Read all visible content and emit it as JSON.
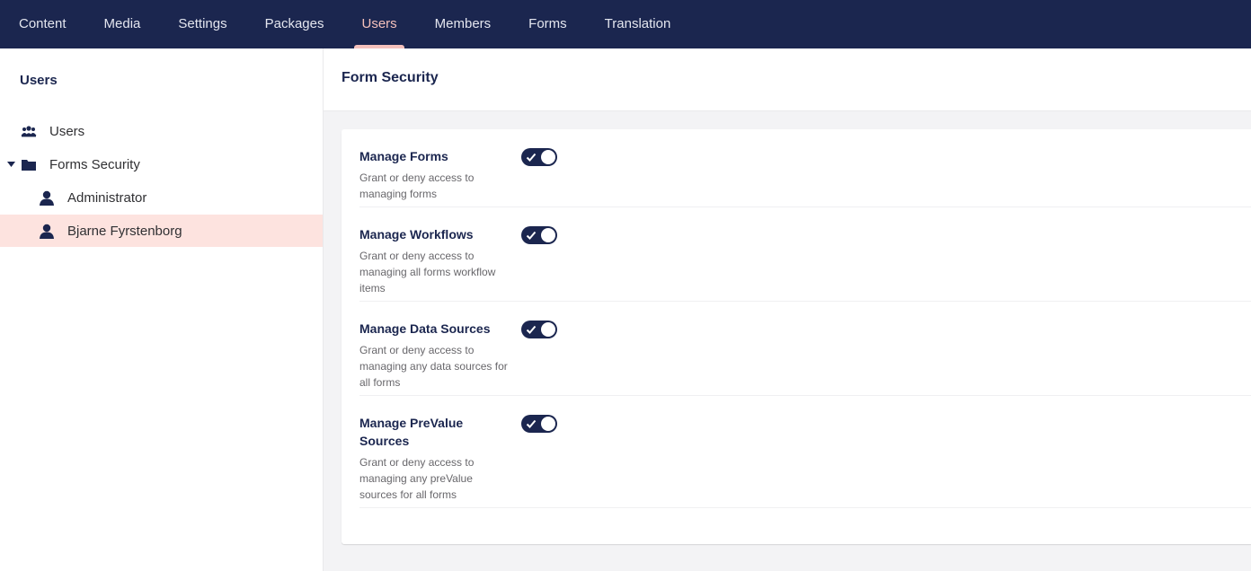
{
  "topnav": {
    "items": [
      {
        "label": "Content"
      },
      {
        "label": "Media"
      },
      {
        "label": "Settings"
      },
      {
        "label": "Packages"
      },
      {
        "label": "Users",
        "active": true
      },
      {
        "label": "Members"
      },
      {
        "label": "Forms"
      },
      {
        "label": "Translation"
      }
    ]
  },
  "sidebar": {
    "title": "Users",
    "tree": [
      {
        "label": "Users",
        "icon": "users-icon"
      },
      {
        "label": "Forms Security",
        "icon": "folder-icon",
        "expanded": true
      },
      {
        "label": "Administrator",
        "icon": "user-icon"
      },
      {
        "label": "Bjarne Fyrstenborg",
        "icon": "user-icon",
        "selected": true
      }
    ]
  },
  "main": {
    "title": "Form Security",
    "permissions": [
      {
        "label": "Manage Forms",
        "description": "Grant or deny access to managing forms",
        "enabled": true
      },
      {
        "label": "Manage Workflows",
        "description": "Grant or deny access to managing all forms workflow items",
        "enabled": true
      },
      {
        "label": "Manage Data Sources",
        "description": "Grant or deny access to managing any data sources for all forms",
        "enabled": true
      },
      {
        "label": "Manage PreValue Sources",
        "description": "Grant or deny access to managing any preValue sources for all forms",
        "enabled": true
      }
    ]
  },
  "colors": {
    "header_bg": "#1b264f",
    "active_accent": "#f5c1bc",
    "selected_row_bg": "#fde3df",
    "toggle_on": "#1b264f"
  }
}
